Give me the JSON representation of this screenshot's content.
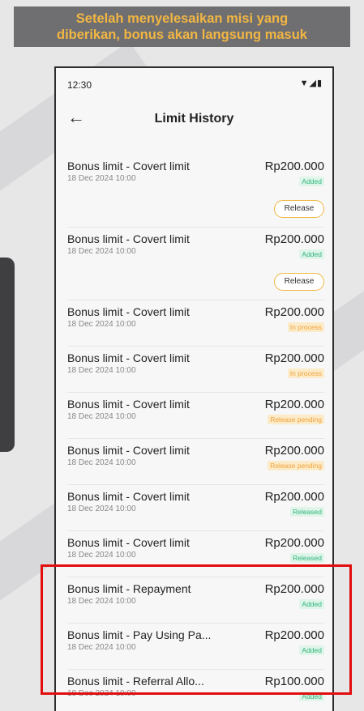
{
  "caption": {
    "line1": "Setelah menyelesaikan misi yang",
    "line2": "diberikan, bonus akan langsung masuk"
  },
  "status_bar": {
    "time": "12:30",
    "icons": "▼◢▮"
  },
  "header": {
    "back_icon": "←",
    "title": "Limit History"
  },
  "items": [
    {
      "name": "Bonus limit - Covert limit",
      "date": "18 Dec 2024 10:00",
      "amount": "Rp200.000",
      "status": "Added",
      "action": "Release"
    },
    {
      "name": "Bonus limit - Covert limit",
      "date": "18 Dec 2024 10:00",
      "amount": "Rp200.000",
      "status": "Added",
      "action": "Release"
    },
    {
      "name": "Bonus limit - Covert limit",
      "date": "18 Dec 2024 10:00",
      "amount": "Rp200.000",
      "status": "In process"
    },
    {
      "name": "Bonus limit - Covert limit",
      "date": "18 Dec 2024 10:00",
      "amount": "Rp200.000",
      "status": "In process"
    },
    {
      "name": "Bonus limit - Covert limit",
      "date": "18 Dec 2024 10:00",
      "amount": "Rp200.000",
      "status": "Release pending"
    },
    {
      "name": "Bonus limit - Covert limit",
      "date": "18 Dec 2024 10:00",
      "amount": "Rp200.000",
      "status": "Release pending"
    },
    {
      "name": "Bonus limit - Covert limit",
      "date": "18 Dec 2024 10:00",
      "amount": "Rp200.000",
      "status": "Released"
    },
    {
      "name": "Bonus limit - Covert limit",
      "date": "18 Dec 2024 10:00",
      "amount": "Rp200.000",
      "status": "Released"
    },
    {
      "name": "Bonus limit - Repayment",
      "date": "18 Dec 2024 10:00",
      "amount": "Rp200.000",
      "status": "Added"
    },
    {
      "name": "Bonus limit - Pay Using Pa...",
      "date": "18 Dec 2024 10:00",
      "amount": "Rp200.000",
      "status": "Added"
    },
    {
      "name": "Bonus limit - Referral Allo...",
      "date": "18 Dec 2024 10:00",
      "amount": "Rp100.000",
      "status": "Added"
    }
  ],
  "colors": {
    "caption_bg": "#6f6f72",
    "caption_text": "#f2b642",
    "added": "#2fb57a",
    "in_process": "#f0a23a",
    "highlight": "#e20d0d"
  }
}
